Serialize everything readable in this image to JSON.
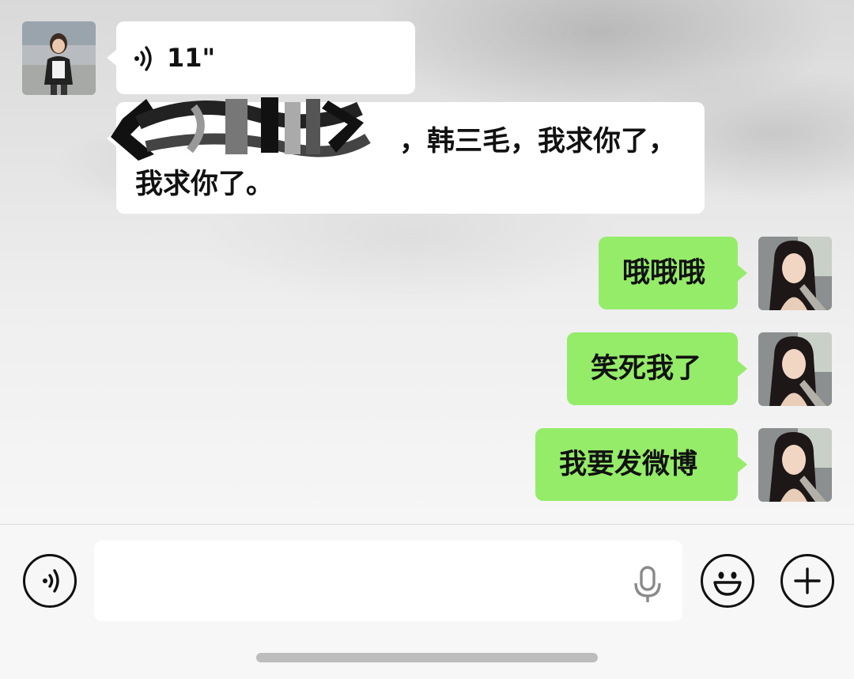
{
  "messages": [
    {
      "side": "left",
      "type": "voice",
      "duration": "11\"",
      "voice_icon": "voice-wave-icon"
    },
    {
      "side": "left",
      "type": "text",
      "redacted": true,
      "line1": "，韩三毛，我求你了，",
      "line2": "我求你了。"
    },
    {
      "side": "right",
      "type": "text",
      "text": "哦哦哦"
    },
    {
      "side": "right",
      "type": "text",
      "text": "笑死我了"
    },
    {
      "side": "right",
      "type": "text",
      "text": "我要发微博"
    }
  ],
  "input_bar": {
    "voice_toggle_icon": "voice-toggle-icon",
    "mic_icon": "microphone-icon",
    "emoji_icon": "emoji-icon",
    "more_icon": "plus-icon",
    "message_value": ""
  },
  "colors": {
    "sent_bubble": "#95ec69",
    "received_bubble": "#ffffff",
    "bar_background": "#f7f7f7"
  }
}
